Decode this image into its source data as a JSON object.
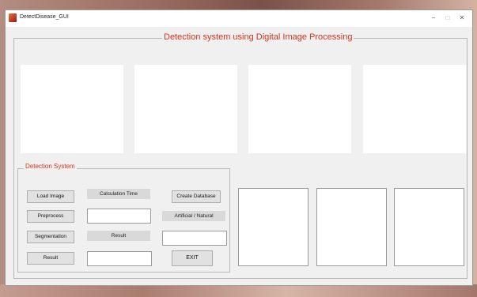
{
  "window": {
    "title": "DetectDisease_GUI",
    "controls": {
      "minimize": "–",
      "maximize": "□",
      "close": "✕"
    }
  },
  "main_panel": {
    "title": "Detection system using Digital Image Processing"
  },
  "detection_panel": {
    "title": "Detection System",
    "buttons": {
      "load_image": "Load Image",
      "preprocess": "Preprocess",
      "segmentation": "Segmentation",
      "result": "Result",
      "create_database": "Create Database",
      "exit": "EXIT"
    },
    "labels": {
      "calculation_time": "Calculation Time",
      "result": "Result",
      "artificial_natural": "Artificial / Natural"
    },
    "fields": {
      "calculation_time_value": "",
      "result_value": "",
      "artificial_natural_value": "",
      "result_edit_value": ""
    }
  },
  "colors": {
    "accent": "#d6331f",
    "panel_bg": "#f0f0f0",
    "button_bg": "#e1e1e1"
  },
  "icons": {
    "app": "matlab-figure-icon"
  }
}
